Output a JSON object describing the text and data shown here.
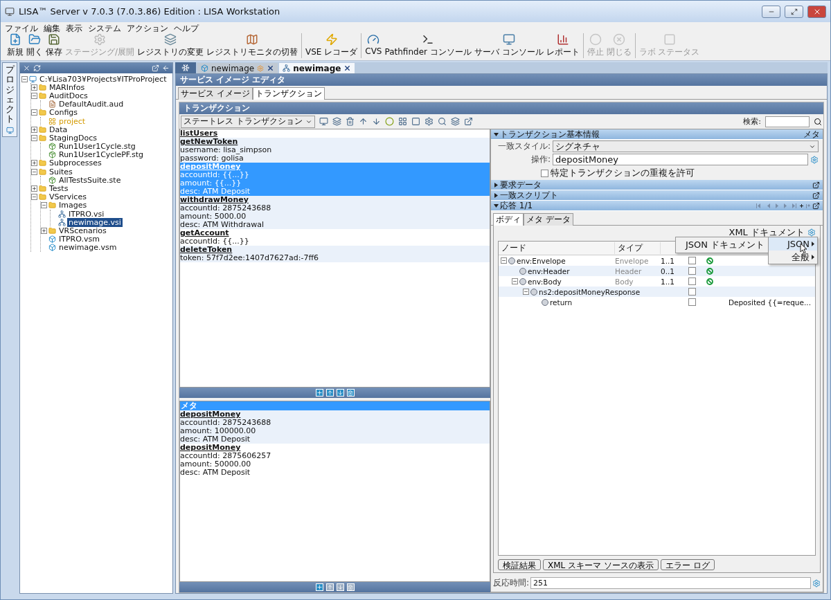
{
  "window": {
    "title": "LISA™ Server v 7.0.3 (7.0.3.86) Edition : LISA Workstation"
  },
  "menu": [
    "ファイル",
    "編集",
    "表示",
    "システム",
    "アクション",
    "ヘルプ"
  ],
  "toolbar": [
    [
      {
        "label": "新規",
        "disabled": false
      },
      {
        "label": "開く",
        "disabled": false
      },
      {
        "label": "保存",
        "disabled": false
      },
      {
        "label": "ステージング/展開",
        "disabled": true
      },
      {
        "label": "レジストリの変更",
        "disabled": false
      },
      {
        "label": "レジストリモニタの切替",
        "disabled": false
      }
    ],
    [
      {
        "label": "VSE レコーダ",
        "disabled": false
      }
    ],
    [
      {
        "label": "CVS",
        "disabled": false
      },
      {
        "label": "Pathfinder コンソール",
        "disabled": false
      },
      {
        "label": "サーバ コンソール",
        "disabled": false
      },
      {
        "label": "レポート",
        "disabled": false
      }
    ],
    [
      {
        "label": "停止",
        "disabled": true
      },
      {
        "label": "閉じる",
        "disabled": true
      }
    ],
    [
      {
        "label": "ラボ ステータス",
        "disabled": true
      }
    ]
  ],
  "project_panel": {
    "side_tab": "プロジェクト",
    "tree": {
      "label": "C:¥Lisa703¥Projects¥ITProProject",
      "kind": "project",
      "selected": false,
      "expanded": true,
      "children": [
        {
          "label": "MARInfos",
          "kind": "folder",
          "selected": false,
          "expanded": false
        },
        {
          "label": "AuditDocs",
          "kind": "folder",
          "selected": false,
          "expanded": true,
          "children": [
            {
              "label": "DefaultAudit.aud",
              "kind": "audit",
              "selected": false
            }
          ]
        },
        {
          "label": "Configs",
          "kind": "folder",
          "selected": false,
          "expanded": true,
          "children": [
            {
              "label": "project",
              "kind": "config",
              "selected": false
            }
          ]
        },
        {
          "label": "Data",
          "kind": "folder",
          "selected": false,
          "expanded": false
        },
        {
          "label": "StagingDocs",
          "kind": "folder",
          "selected": false,
          "expanded": true,
          "children": [
            {
              "label": "Run1User1Cycle.stg",
              "kind": "staging",
              "selected": false
            },
            {
              "label": "Run1User1CyclePF.stg",
              "kind": "staging",
              "selected": false
            }
          ]
        },
        {
          "label": "Subprocesses",
          "kind": "folder",
          "selected": false,
          "expanded": false
        },
        {
          "label": "Suites",
          "kind": "folder",
          "selected": false,
          "expanded": true,
          "children": [
            {
              "label": "AllTestsSuite.ste",
              "kind": "suite",
              "selected": false
            }
          ]
        },
        {
          "label": "Tests",
          "kind": "folder",
          "selected": false,
          "expanded": false
        },
        {
          "label": "VServices",
          "kind": "folder",
          "selected": false,
          "expanded": true,
          "children": [
            {
              "label": "Images",
              "kind": "folder",
              "selected": false,
              "expanded": true,
              "children": [
                {
                  "label": "ITPRO.vsi",
                  "kind": "image",
                  "selected": false
                },
                {
                  "label": "newimage.vsi",
                  "kind": "image",
                  "selected": true
                }
              ]
            },
            {
              "label": "VRScenarios",
              "kind": "folder",
              "selected": false,
              "expanded": false
            },
            {
              "label": "ITPRO.vsm",
              "kind": "model",
              "selected": false
            },
            {
              "label": "newimage.vsm",
              "kind": "model",
              "selected": false
            }
          ]
        }
      ]
    }
  },
  "editor_tabs": [
    {
      "label": "newimage",
      "kind": "model",
      "modified": true,
      "selected": false
    },
    {
      "label": "newimage",
      "kind": "image",
      "modified": false,
      "selected": true
    }
  ],
  "editor": {
    "title": "サービス イメージ エディタ",
    "tabs": [
      {
        "label": "サービス イメージ",
        "selected": false
      },
      {
        "label": "トランザクション",
        "selected": true
      }
    ],
    "panel_title": "トランザクション",
    "mode": "ステートレス トランザクション",
    "search_label": "検索:",
    "transactions": [
      {
        "name": "listUsers",
        "selected": false
      },
      {
        "name": "getNewToken",
        "lines": [
          "username: lisa_simpson",
          "password: golisa"
        ],
        "selected": false
      },
      {
        "name": "depositMoney",
        "lines": [
          "accountId: {{...}}",
          "amount: {{...}}",
          "desc: ATM Deposit"
        ],
        "selected": true
      },
      {
        "name": "withdrawMoney",
        "lines": [
          "accountId: 2875243688",
          "amount: 5000.00",
          "desc: ATM Withdrawal"
        ],
        "selected": false
      },
      {
        "name": "getAccount",
        "lines": [
          "accountId: {{...}}"
        ],
        "selected": false
      },
      {
        "name": "deleteToken",
        "lines": [
          "token: 57f7d2ee:1407d7627ad:-7ff6"
        ],
        "selected": false
      }
    ],
    "meta_title": "メタ",
    "meta_transactions": [
      {
        "name": "depositMoney",
        "lines": [
          "accountId: 2875243688",
          "amount: 100000.00",
          "desc: ATM Deposit"
        ]
      },
      {
        "name": "depositMoney",
        "lines": [
          "accountId: 2875606257",
          "amount: 50000.00",
          "desc: ATM Deposit"
        ]
      }
    ]
  },
  "details": {
    "basic_info": {
      "title": "トランザクション基本情報",
      "expanded": true,
      "meta_label": "メタ",
      "match_style": {
        "label": "一致スタイル:",
        "value": "シグネチャ"
      },
      "operation": {
        "label": "操作:",
        "value": "depositMoney"
      },
      "allow_duplicate": {
        "label": "特定トランザクションの重複を許可",
        "checked": false
      }
    },
    "sections": [
      {
        "title": "要求データ",
        "expanded": false
      },
      {
        "title": "一致スクリプト",
        "expanded": false
      }
    ],
    "response": {
      "title": "応答 1/1",
      "expanded": true,
      "tabs": [
        {
          "label": "ボディ",
          "selected": true
        },
        {
          "label": "メタ データ",
          "selected": false
        }
      ],
      "doc_type": "XML ドキュメント",
      "columns": [
        "ノード",
        "タイプ"
      ],
      "rows": [
        {
          "node": "env:Envelope",
          "type": "Envelope",
          "cardinality": "1..1",
          "checked": false,
          "valid": true,
          "expanded": true,
          "children": [
            {
              "node": "env:Header",
              "type": "Header",
              "cardinality": "0..1",
              "checked": false,
              "valid": true
            },
            {
              "node": "env:Body",
              "type": "Body",
              "cardinality": "1..1",
              "checked": false,
              "valid": true,
              "expanded": true,
              "children": [
                {
                  "node": "ns2:depositMoneyResponse",
                  "checked": false,
                  "expanded": true,
                  "children": [
                    {
                      "node": "return",
                      "checked": false,
                      "value": "Deposited {{=reque..."
                    }
                  ]
                }
              ]
            }
          ]
        }
      ],
      "buttons": [
        "検証結果",
        "XML スキーマ ソースの表示",
        "エラー ログ"
      ],
      "response_time": {
        "label": "反応時間:",
        "value": "251"
      }
    },
    "context_menu": {
      "items": [
        {
          "label": "JSON",
          "selected": true
        },
        {
          "label": "全般",
          "selected": false
        }
      ],
      "submenu": [
        "JSON ドキュメント"
      ]
    }
  }
}
